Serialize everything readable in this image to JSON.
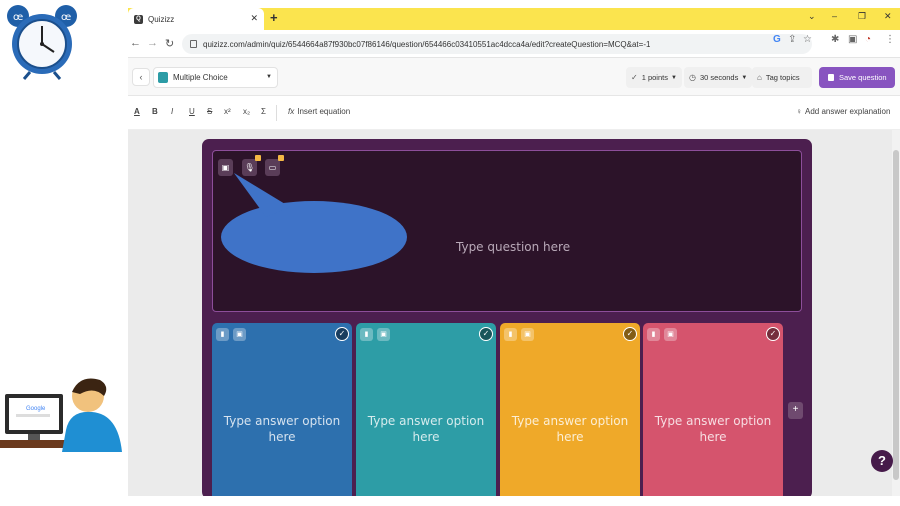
{
  "browser": {
    "tab_title": "Quizizz",
    "tab_close": "✕",
    "new_tab": "+",
    "window_controls": [
      "⌄",
      "–",
      "❐",
      "✕"
    ],
    "url": "quizizz.com/admin/quiz/6544664a87f930bc07f86146/question/654466c03410551ac4dcca4a/edit?createQuestion=MCQ&at=-1",
    "nav": {
      "back": "←",
      "forward": "→",
      "reload": "↻"
    },
    "omnibox_icons": [
      "G",
      "⇪",
      "☆"
    ],
    "extension_icons": [
      "✱",
      "▣",
      "◔",
      "⋮"
    ]
  },
  "toolbar": {
    "back": "‹",
    "question_type": "Multiple Choice",
    "points": "1 points",
    "time": "30 seconds",
    "tag_topics": "Tag topics",
    "save_question": "Save question"
  },
  "format_bar": {
    "buttons": [
      "A",
      "B",
      "I",
      "U",
      "S",
      "x²",
      "x₂",
      "Σ"
    ],
    "insert_equation": "Insert equation",
    "add_explanation": "Add answer explanation"
  },
  "question": {
    "placeholder": "Type question here",
    "media_buttons": [
      "image-icon",
      "mic-icon",
      "video-icon"
    ]
  },
  "answers": [
    {
      "placeholder": "Type answer option here",
      "color": "#2d70ae"
    },
    {
      "placeholder": "Type answer option here",
      "color": "#2d9da6"
    },
    {
      "placeholder": "Type answer option here",
      "color": "#efa929"
    },
    {
      "placeholder": "Type answer option here",
      "color": "#d5546d"
    }
  ],
  "add_answer": "+",
  "help": "?",
  "colors": {
    "accent": "#8854c0",
    "editor_bg": "#4c1f4f",
    "question_bg": "#2c1329",
    "tabstrip": "#fbe44e",
    "speech_bubble": "#3f73c8"
  }
}
